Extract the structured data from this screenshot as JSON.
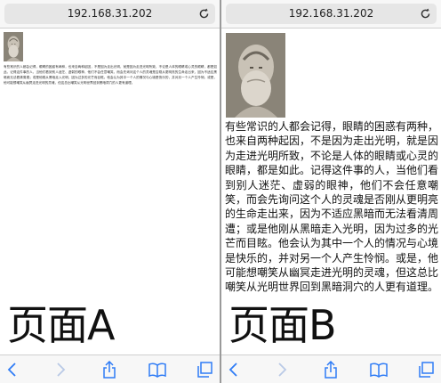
{
  "panel_a": {
    "url": "192.168.31.202",
    "label": "页面A",
    "body_text": "有些常识的人都会记得，眼睛的困惑有两种，也来自两种起因，不是因为走出光明，就是因为走进光明所致，不论是人体的眼睛或心灵的眼睛，都是如此。记得这件事的人，当他们看到别人迷茫、虚弱的眼神，他们不会任意嘲笑，而会先询问这个人的灵魂是否刚从更明亮的生命走出来，因为不适应黑暗而无法看清周遭；或是他刚从黑暗走入光明，因为过多的光芒而目眩。他会认为其中一个人的情况与心境是快乐的，并对另一个人产生怜悯。或是，他可能想嘲笑从幽冥走进光明的灵魂，但这总比嘲笑从光明世界回到黑暗洞穴的人更有道理。"
  },
  "panel_b": {
    "url": "192.168.31.202",
    "label": "页面B",
    "body_text": "有些常识的人都会记得，眼睛的困惑有两种，也来自两种起因，不是因为走出光明，就是因为走进光明所致，不论是人体的眼睛或心灵的眼睛，都是如此。记得这件事的人，当他们看到别人迷茫、虚弱的眼神，他们不会任意嘲笑，而会先询问这个人的灵魂是否刚从更明亮的生命走出来，因为不适应黑暗而无法看清周遭；或是他刚从黑暗走入光明，因为过多的光芒而目眩。他会认为其中一个人的情况与心境是快乐的，并对另一个人产生怜悯。或是，他可能想嘲笑从幽冥走进光明的灵魂，但这总比嘲笑从光明世界回到黑暗洞穴的人更有道理。"
  },
  "toolbar": {
    "icons": [
      "back-icon",
      "forward-icon",
      "share-icon",
      "bookmarks-icon",
      "tabs-icon"
    ],
    "active_color": "#2f7cf6",
    "disabled_color": "#b9c9e6"
  }
}
